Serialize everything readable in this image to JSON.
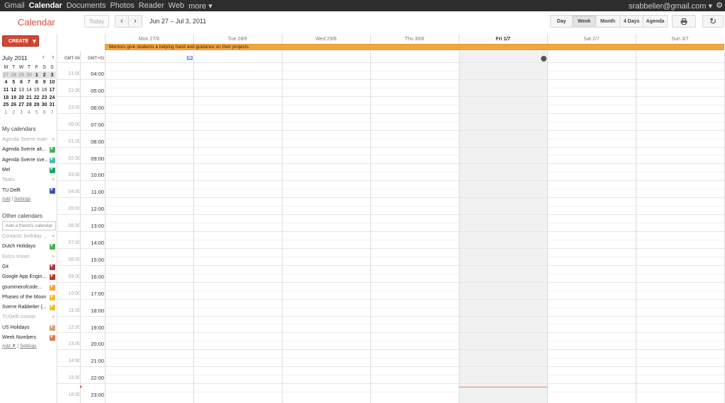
{
  "gbar": {
    "nav": [
      "Gmail",
      "Calendar",
      "Documents",
      "Photos",
      "Reader",
      "Web",
      "more ▾"
    ],
    "active": "Calendar",
    "account": "srabbelier@gmail.com ▾"
  },
  "header": {
    "logo": "Calendar",
    "today": "Today",
    "prev": "‹",
    "next": "›",
    "date_range": "Jun 27 – Jul 3, 2011",
    "views": [
      "Day",
      "Week",
      "Month",
      "4 Days",
      "Agenda"
    ],
    "selected_view": "Week",
    "print_icon": "printer-icon",
    "refresh_icon": "refresh-icon"
  },
  "create": {
    "label": "CREATE",
    "arrow": "▼"
  },
  "mini": {
    "title": "July 2011",
    "nav": "‹ ›",
    "dow": [
      "M",
      "T",
      "W",
      "T",
      "F",
      "S",
      "S"
    ],
    "weeks": [
      [
        {
          "d": "27",
          "c": "dim"
        },
        {
          "d": "28",
          "c": "dim"
        },
        {
          "d": "29",
          "c": "dim"
        },
        {
          "d": "30",
          "c": "dim"
        },
        {
          "d": "1",
          "c": "bold"
        },
        {
          "d": "2",
          "c": "bold"
        },
        {
          "d": "3",
          "c": "bold"
        }
      ],
      [
        {
          "d": "4",
          "c": "bold"
        },
        {
          "d": "5",
          "c": "bold"
        },
        {
          "d": "6",
          "c": "bold"
        },
        {
          "d": "7",
          "c": "bold"
        },
        {
          "d": "8",
          "c": "bold"
        },
        {
          "d": "9",
          "c": "bold"
        },
        {
          "d": "10",
          "c": "bold"
        }
      ],
      [
        {
          "d": "11",
          "c": "bold"
        },
        {
          "d": "12",
          "c": "bold"
        },
        {
          "d": "13",
          "c": ""
        },
        {
          "d": "14",
          "c": ""
        },
        {
          "d": "15",
          "c": ""
        },
        {
          "d": "16",
          "c": ""
        },
        {
          "d": "17",
          "c": "bold"
        }
      ],
      [
        {
          "d": "18",
          "c": "bold"
        },
        {
          "d": "19",
          "c": "bold"
        },
        {
          "d": "20",
          "c": "bold"
        },
        {
          "d": "21",
          "c": "bold"
        },
        {
          "d": "22",
          "c": "bold"
        },
        {
          "d": "23",
          "c": "bold"
        },
        {
          "d": "24",
          "c": "bold"
        }
      ],
      [
        {
          "d": "25",
          "c": "bold"
        },
        {
          "d": "26",
          "c": "bold"
        },
        {
          "d": "27",
          "c": "bold"
        },
        {
          "d": "28",
          "c": "bold"
        },
        {
          "d": "29",
          "c": "bold"
        },
        {
          "d": "30",
          "c": "bold"
        },
        {
          "d": "31",
          "c": "bold"
        }
      ],
      [
        {
          "d": "1",
          "c": "dim"
        },
        {
          "d": "2",
          "c": "dim"
        },
        {
          "d": "3",
          "c": "dim"
        },
        {
          "d": "4",
          "c": "dim"
        },
        {
          "d": "5",
          "c": "dim"
        },
        {
          "d": "6",
          "c": "dim"
        },
        {
          "d": "7",
          "c": "dim"
        }
      ]
    ]
  },
  "my_calendars": {
    "title": "My calendars",
    "items": [
      {
        "name": "Agenda Sverre main",
        "color": "",
        "dim": true
      },
      {
        "name": "Agenda Sverre alt...",
        "color": "#4cb052",
        "dim": false
      },
      {
        "name": "Agenda Sverre sve...",
        "color": "#42c2b0",
        "dim": false
      },
      {
        "name": "Mel",
        "color": "#16a765",
        "dim": false
      },
      {
        "name": "Tasks",
        "color": "",
        "dim": true
      },
      {
        "name": "TU Delft",
        "color": "#3f51b5",
        "dim": false
      }
    ],
    "add": "Add",
    "settings": "Settings"
  },
  "other_calendars": {
    "title": "Other calendars",
    "placeholder": "Add a friend's calendar",
    "items": [
      {
        "name": "Contacts' birthday ...",
        "color": "",
        "dim": true
      },
      {
        "name": "Dutch Holidays",
        "color": "#4cb052",
        "dim": false
      },
      {
        "name": "Eelco Visser",
        "color": "",
        "dim": true
      },
      {
        "name": "Git",
        "color": "#b3374b",
        "dim": false
      },
      {
        "name": "Google App Engin...",
        "color": "#c0392b",
        "dim": false
      },
      {
        "name": "gsummerofcode...",
        "color": "#f2a640",
        "dim": false
      },
      {
        "name": "Phases of the Moon",
        "color": "#e6c229",
        "dim": false
      },
      {
        "name": "Sverre Rabbelier (...",
        "color": "#e6c229",
        "dim": false
      },
      {
        "name": "TUDelft rooster",
        "color": "",
        "dim": true
      },
      {
        "name": "US Holidays",
        "color": "#d7a273",
        "dim": false
      },
      {
        "name": "Week Numbers",
        "color": "#e07b53",
        "dim": false
      }
    ],
    "add": "Add ▼",
    "settings": "Settings"
  },
  "days": [
    "Mon 27/6",
    "Tue 28/6",
    "Wed 29/6",
    "Thu 30/6",
    "Fri 1/7",
    "Sat 2/7",
    "Sun 3/7"
  ],
  "today_index": 4,
  "allday_event": "Mentors give students a helping hand and guidance on their projects.",
  "week_number": "26",
  "tz": {
    "a": "GMT-06",
    "b": "GMT+01"
  },
  "times_a": [
    "21:00",
    "22:00",
    "23:00",
    "00:00",
    "01:00",
    "02:00",
    "03:00",
    "04:00",
    "05:00",
    "06:00",
    "07:00",
    "08:00",
    "09:00",
    "10:00",
    "11:00",
    "12:00",
    "13:00",
    "14:00",
    "15:00",
    "16:00"
  ],
  "times_b": [
    "04:00",
    "05:00",
    "06:00",
    "07:00",
    "08:00",
    "09:00",
    "10:00",
    "11:00",
    "12:00",
    "13:00",
    "14:00",
    "15:00",
    "16:00",
    "17:00",
    "18:00",
    "19:00",
    "20:00",
    "21:00",
    "22:00",
    "23:00"
  ]
}
